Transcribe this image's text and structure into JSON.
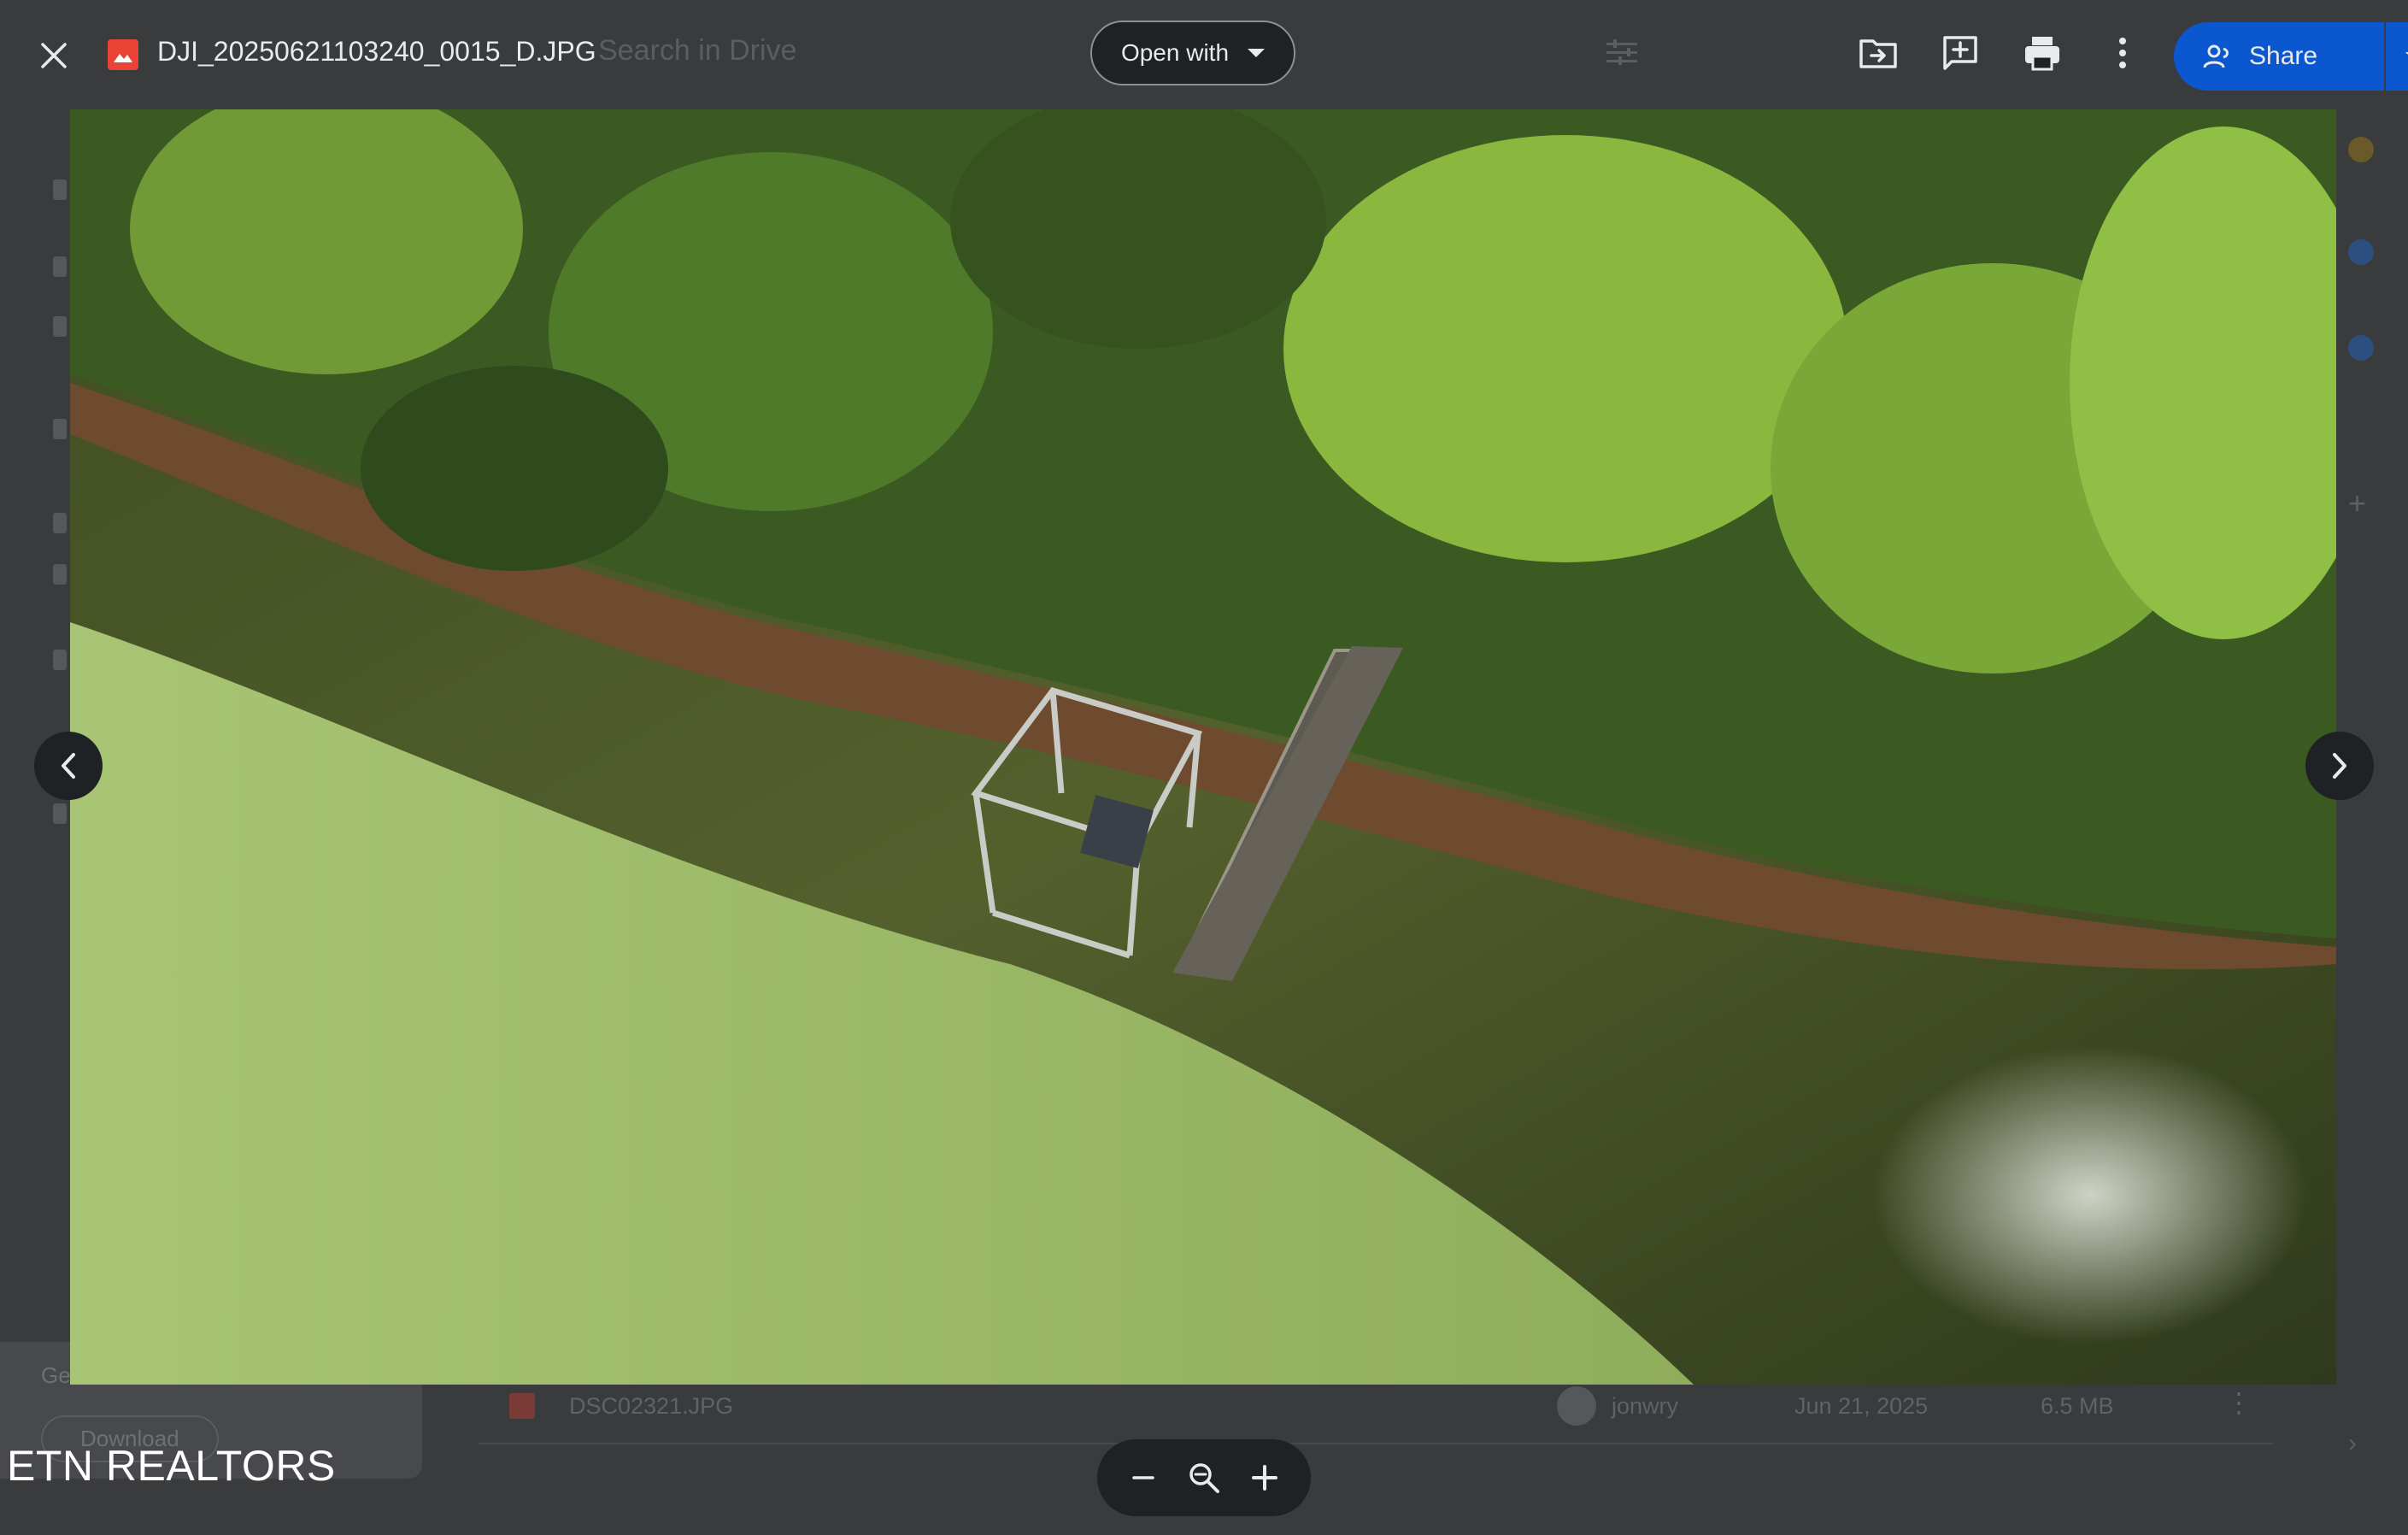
{
  "header": {
    "file_name": "DJI_20250621103240_0015_D.JPG",
    "open_with_label": "Open with",
    "share_label": "Share"
  },
  "background": {
    "search_text": "Search in Drive",
    "panel_title": "Get",
    "panel_button": "Download",
    "file_row": {
      "name": "DSC02321.JPG",
      "owner": "jonwry",
      "date": "Jun 21, 2025",
      "size": "6.5 MB"
    }
  },
  "watermark": "ETN REALTORS",
  "icons": {
    "close": "close-icon",
    "file_type": "image-file-icon",
    "filter": "filter-icon",
    "move": "move-to-folder-icon",
    "add_comment": "add-comment-icon",
    "print": "print-icon",
    "more": "more-vert-icon",
    "share": "person-add-icon",
    "prev": "chevron-left-icon",
    "next": "chevron-right-icon",
    "zoom_out": "minus-icon",
    "zoom_reset": "magnifier-icon",
    "zoom_in": "plus-icon"
  },
  "colors": {
    "share_blue": "#0b57d0",
    "toolbar_bg": "#202124",
    "image_icon_red": "#ea4335"
  }
}
